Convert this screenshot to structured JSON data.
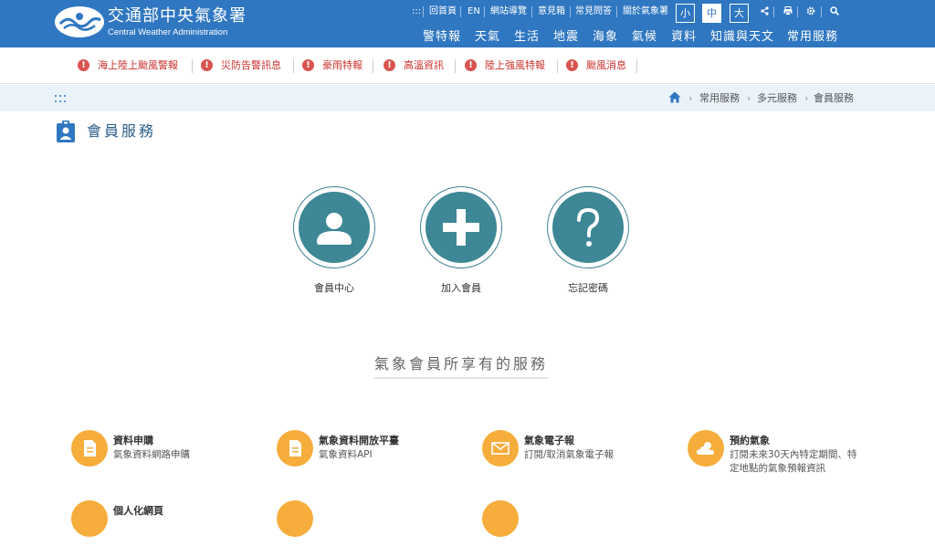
{
  "header": {
    "site_name": "交通部中央氣象署",
    "site_subtitle": "Central Weather Administration",
    "utility_links": [
      ":::",
      "回首頁",
      "EN",
      "網站導覽",
      "意見箱",
      "常見問答",
      "關於氣象署"
    ],
    "font_sizes": [
      "小",
      "中",
      "大"
    ],
    "active_font_size": "中",
    "main_nav": [
      "警特報",
      "天氣",
      "生活",
      "地震",
      "海象",
      "氣候",
      "資料",
      "知識與天文",
      "常用服務"
    ]
  },
  "alerts": [
    "海上陸上颱風警報",
    "災防告警訊息",
    "豪雨特報",
    "高溫資訊",
    "陸上強風特報",
    "颱風消息"
  ],
  "breadcrumb": [
    "常用服務",
    "多元服務",
    "會員服務"
  ],
  "page_title": "會員服務",
  "actions": [
    {
      "label": "會員中心",
      "icon": "user-icon"
    },
    {
      "label": "加入會員",
      "icon": "plus-icon"
    },
    {
      "label": "忘記密碼",
      "icon": "question-icon"
    }
  ],
  "section_title": "氣象會員所享有的服務",
  "services": [
    {
      "title": "資料申購",
      "desc": "氣象資料網路申購",
      "icon": "document-icon"
    },
    {
      "title": "氣象資料開放平臺",
      "desc": "氣象資料API",
      "icon": "document-icon"
    },
    {
      "title": "氣象電子報",
      "desc": "訂閱/取消氣象電子報",
      "icon": "mail-icon"
    },
    {
      "title": "預約氣象",
      "desc": "訂閱未來30天內特定期間、特定地點的氣象預報資訊",
      "icon": "cloud-icon"
    },
    {
      "title": "個人化網頁",
      "desc": "",
      "icon": "user-icon"
    }
  ],
  "colors": {
    "header_bg": "#2f77c1",
    "alert_text": "#c9302c",
    "action_circle": "#3d8796",
    "service_icon": "#f6ad3b"
  }
}
